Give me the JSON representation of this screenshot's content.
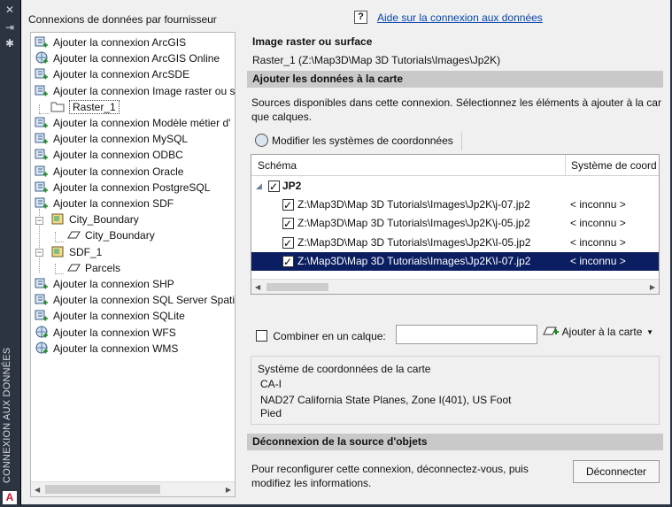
{
  "sidebar": {
    "vertical_title": "CONNEXION AUX DONNÉES",
    "close_glyph": "✕",
    "pin_glyph": "⇥",
    "props_glyph": "✱",
    "logo_letter": "A"
  },
  "left_panel": {
    "title": "Connexions de données par fournisseur",
    "tree": [
      {
        "label": "Ajouter la connexion ArcGIS",
        "icon": "arcgis-connection-icon"
      },
      {
        "label": "Ajouter la connexion ArcGIS Online",
        "icon": "arcgis-online-globe-icon"
      },
      {
        "label": "Ajouter la connexion ArcSDE",
        "icon": "arcsde-connection-icon"
      },
      {
        "label": "Ajouter la connexion Image raster ou s",
        "icon": "raster-connection-icon"
      },
      {
        "label": "Raster_1",
        "icon": "folder-icon"
      },
      {
        "label": "Ajouter la connexion Modèle métier d'",
        "icon": "business-model-connection-icon"
      },
      {
        "label": "Ajouter la connexion MySQL",
        "icon": "mysql-connection-icon"
      },
      {
        "label": "Ajouter la connexion ODBC",
        "icon": "odbc-connection-icon"
      },
      {
        "label": "Ajouter la connexion Oracle",
        "icon": "oracle-connection-icon"
      },
      {
        "label": "Ajouter la connexion PostgreSQL",
        "icon": "postgresql-connection-icon"
      },
      {
        "label": "Ajouter la connexion SDF",
        "icon": "sdf-connection-icon"
      },
      {
        "label": "City_Boundary",
        "icon": "feature-source-icon"
      },
      {
        "label": "City_Boundary",
        "icon": "polygon-layer-icon"
      },
      {
        "label": "SDF_1",
        "icon": "feature-source-icon"
      },
      {
        "label": "Parcels",
        "icon": "polygon-layer-icon"
      },
      {
        "label": "Ajouter la connexion SHP",
        "icon": "shp-connection-icon"
      },
      {
        "label": "Ajouter la connexion SQL Server Spatia",
        "icon": "sqlserver-connection-icon"
      },
      {
        "label": "Ajouter la connexion SQLite",
        "icon": "sqlite-connection-icon"
      },
      {
        "label": "Ajouter la connexion WFS",
        "icon": "wfs-globe-icon"
      },
      {
        "label": "Ajouter la connexion WMS",
        "icon": "wms-globe-icon"
      }
    ]
  },
  "help": {
    "glyph": "?",
    "link": "Aide sur la connexion aux données"
  },
  "source": {
    "heading": "Image raster ou surface",
    "path": "Raster_1 (Z:\\Map3D\\Map 3D Tutorials\\Images\\Jp2K)"
  },
  "add_section": {
    "bar_title": "Ajouter les données à la carte",
    "description_line1": "Sources disponibles dans cette connexion. Sélectionnez les éléments à ajouter à la car",
    "description_line2": "que calques.",
    "modify_cs_button": "Modifier les systèmes de coordonnées",
    "columns": [
      "Schéma",
      "Système de coord"
    ],
    "group_label": "JP2",
    "rows": [
      {
        "path": "Z:\\Map3D\\Map 3D Tutorials\\Images\\Jp2K\\j-07.jp2",
        "cs": "< inconnu >",
        "checked": true,
        "selected": false
      },
      {
        "path": "Z:\\Map3D\\Map 3D Tutorials\\Images\\Jp2K\\j-05.jp2",
        "cs": "< inconnu >",
        "checked": true,
        "selected": false
      },
      {
        "path": "Z:\\Map3D\\Map 3D Tutorials\\Images\\Jp2K\\I-05.jp2",
        "cs": "< inconnu >",
        "checked": true,
        "selected": false
      },
      {
        "path": "Z:\\Map3D\\Map 3D Tutorials\\Images\\Jp2K\\I-07.jp2",
        "cs": "< inconnu >",
        "checked": true,
        "selected": true
      }
    ],
    "combine_label": "Combiner en un calque:",
    "combine_value": "",
    "add_to_map_button": "Ajouter à la carte",
    "map_cs_legend": "Système de coordonnées de la carte",
    "map_cs_code": "CA-I",
    "map_cs_desc": "NAD27 California State Planes, Zone I(401), US Foot",
    "map_cs_desc2": "Pied"
  },
  "disconnect_section": {
    "bar_title": "Déconnexion de la source d'objets",
    "text": "Pour reconfigurer cette connexion, déconnectez-vous, puis modifiez les informations.",
    "button": "Déconnecter"
  },
  "colors": {
    "selection": "#0b1e62",
    "link": "#0645ad",
    "sidebar": "#2b3440",
    "section_bar": "#c9c9c9"
  }
}
